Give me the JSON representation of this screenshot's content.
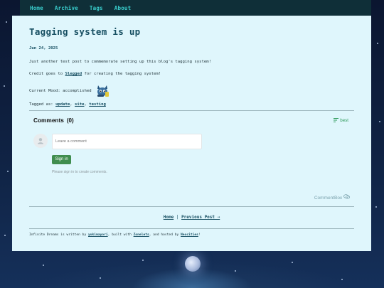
{
  "nav": {
    "items": [
      "Home",
      "Archive",
      "Tags",
      "About"
    ]
  },
  "post": {
    "title": "Tagging system is up",
    "date": "Jun 24, 2025",
    "body1": "Just another test post to commemorate setting up this blog's tagging system!",
    "body2_pre": "Credit goes to ",
    "body2_link": "Slegged",
    "body2_post": " for creating the tagging system!",
    "mood_label": "Current Mood: accomplished",
    "mood_icon": "accomplished-creature-icon",
    "tagged_label": "Tagged as:",
    "tags": [
      "update",
      "site",
      "testing"
    ]
  },
  "comments": {
    "title": "Comments",
    "count": "(0)",
    "sort_label": "best",
    "sort_icon": "sort-icon",
    "placeholder": "Leave a comment",
    "signin_label": "Sign in",
    "signin_note": "Please sign in to create comments.",
    "brand": "CommentBox"
  },
  "postnav": {
    "home": "Home",
    "sep": "|",
    "prev": "Previous Post ⇒"
  },
  "footer": {
    "t1": "Infinite Dreams is written by ",
    "author": "yukimayori",
    "t2": ", built with ",
    "builder": "Zonelets",
    "t3": ", and hosted by ",
    "host": "Neocities",
    "t4": "!"
  },
  "colors": {
    "nav_bg": "#0f2f38",
    "nav_link": "#3ad0cf",
    "page_bg": "#dff6fc",
    "accent": "#174f62",
    "signin_bg": "#3f8d4e"
  }
}
